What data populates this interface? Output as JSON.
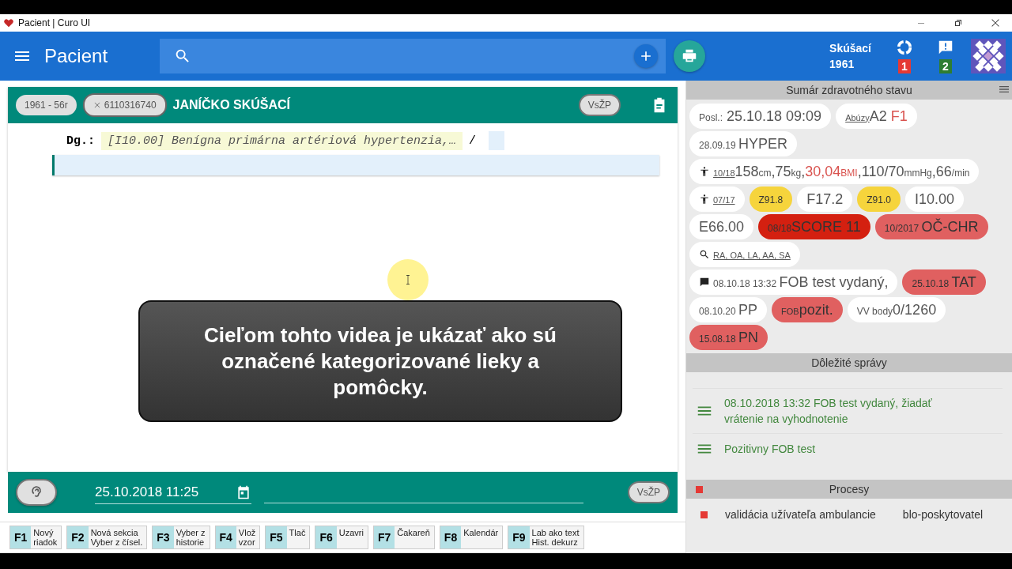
{
  "window": {
    "title": "Pacient | Curo UI"
  },
  "appbar": {
    "title": "Pacient",
    "user": {
      "name": "Skúšací",
      "year": "1961"
    },
    "sync_badge": "1",
    "messages_badge": "2"
  },
  "patient": {
    "age_chip": "1961 - 56r",
    "id_chip": "6110316740",
    "name": "JANÍČKO SKÚŠACÍ",
    "insurer": "VsŽP"
  },
  "editor": {
    "label": "Dg.:",
    "diagnosis": "[I10.00] Benígna primárna artériová hypertenzia,…",
    "separator": "/"
  },
  "caption": "Cieľom tohto videa je ukázať ako sú označené kategorizované lieky a pomôcky.",
  "footer": {
    "date": "25.10.2018 11:25",
    "insurer": "VsŽP"
  },
  "fkeys": [
    {
      "key": "F1",
      "label": "Nový\nriadok"
    },
    {
      "key": "F2",
      "label": "Nová sekcia\nVyber z čísel."
    },
    {
      "key": "F3",
      "label": "Vyber z\nhistorie"
    },
    {
      "key": "F4",
      "label": "Vlož\nvzor"
    },
    {
      "key": "F5",
      "label": "Tlač"
    },
    {
      "key": "F6",
      "label": "Uzavri"
    },
    {
      "key": "F7",
      "label": "Čakareň"
    },
    {
      "key": "F8",
      "label": "Kalendár"
    },
    {
      "key": "F9",
      "label": "Lab ako text\nHist. dekurz"
    }
  ],
  "summary": {
    "title": "Sumár zdravotného stavu",
    "chips": [
      {
        "color": "#ffffff",
        "kind": "plain",
        "parts": [
          {
            "text": "Posl.:",
            "kind": "small"
          },
          {
            "text": " 25.10.18 09:09",
            "kind": "value"
          }
        ]
      },
      {
        "color": "#ffffff",
        "kind": "plain",
        "parts": [
          {
            "text": "Abúzy",
            "kind": "link"
          },
          {
            "text": "A2 ",
            "kind": "value"
          },
          {
            "text": "F1",
            "kind": "alert"
          }
        ]
      },
      {
        "color": "#ffffff",
        "kind": "plain",
        "parts": [
          {
            "text": "28.09.19 ",
            "kind": "small"
          },
          {
            "text": "HYPER",
            "kind": "value"
          }
        ]
      },
      {
        "color": "#ffffff",
        "kind": "body",
        "parts": [
          {
            "text": "10/18",
            "kind": "link"
          },
          {
            "text": "158",
            "kind": "value"
          },
          {
            "text": "cm",
            "kind": "unit"
          },
          {
            "text": ",75",
            "kind": "value"
          },
          {
            "text": "kg",
            "kind": "unit"
          },
          {
            "text": ",",
            "kind": "value"
          },
          {
            "text": "30,04",
            "kind": "alert"
          },
          {
            "text": "BMI",
            "kind": "alertunit"
          },
          {
            "text": ",110/70",
            "kind": "value"
          },
          {
            "text": "mmHg",
            "kind": "unit"
          },
          {
            "text": ",66",
            "kind": "value"
          },
          {
            "text": "/min",
            "kind": "unit"
          }
        ]
      },
      {
        "color": "#ffffff",
        "kind": "body",
        "parts": [
          {
            "text": "07/17",
            "kind": "link"
          }
        ]
      },
      {
        "color": "#f6d43c",
        "kind": "plain",
        "parts": [
          {
            "text": "Z91.8",
            "kind": "small"
          }
        ]
      },
      {
        "color": "#ffffff",
        "kind": "plain",
        "parts": [
          {
            "text": "F17.2",
            "kind": "value"
          }
        ]
      },
      {
        "color": "#f6d43c",
        "kind": "plain",
        "parts": [
          {
            "text": "Z91.0",
            "kind": "small"
          }
        ]
      },
      {
        "color": "#ffffff",
        "kind": "plain",
        "parts": [
          {
            "text": "I10.00",
            "kind": "value"
          }
        ]
      },
      {
        "color": "#ffffff",
        "kind": "plain",
        "parts": [
          {
            "text": "E66.00",
            "kind": "value"
          }
        ]
      },
      {
        "color": "#d42010",
        "kind": "plain",
        "parts": [
          {
            "text": "08/18",
            "kind": "small"
          },
          {
            "text": "SCORE 11",
            "kind": "value"
          }
        ]
      },
      {
        "color": "#e06060",
        "kind": "plain",
        "parts": [
          {
            "text": "10/2017 ",
            "kind": "small"
          },
          {
            "text": "OČ-CHR",
            "kind": "value"
          }
        ]
      },
      {
        "color": "#ffffff",
        "kind": "lookup",
        "parts": [
          {
            "text": "RA, OA, LA, AA, SA",
            "kind": "link"
          }
        ]
      },
      {
        "color": "#ffffff",
        "kind": "note",
        "parts": [
          {
            "text": "08.10.18 13:32 ",
            "kind": "small"
          },
          {
            "text": "FOB test vydaný,",
            "kind": "value"
          }
        ]
      },
      {
        "color": "#e06060",
        "kind": "plain",
        "parts": [
          {
            "text": "25.10.18 ",
            "kind": "small"
          },
          {
            "text": "TAT",
            "kind": "value"
          }
        ]
      },
      {
        "color": "#ffffff",
        "kind": "plain",
        "parts": [
          {
            "text": "08.10.20 ",
            "kind": "small"
          },
          {
            "text": "PP",
            "kind": "value"
          }
        ]
      },
      {
        "color": "#e06060",
        "kind": "plain",
        "parts": [
          {
            "text": "FOB",
            "kind": "tiny"
          },
          {
            "text": "pozit.",
            "kind": "value"
          }
        ]
      },
      {
        "color": "#ffffff",
        "kind": "plain",
        "parts": [
          {
            "text": "VV body",
            "kind": "small"
          },
          {
            "text": "0/1260",
            "kind": "value"
          }
        ]
      },
      {
        "color": "#e06060",
        "kind": "plain",
        "parts": [
          {
            "text": "15.08.18 ",
            "kind": "small"
          },
          {
            "text": "PN",
            "kind": "value"
          }
        ]
      }
    ]
  },
  "messages": {
    "title": "Dôležité správy",
    "items": [
      "08.10.2018 13:32 FOB test vydaný, žiadať vrátenie na vyhodnotenie",
      "Pozitivny FOB test"
    ]
  },
  "processes": {
    "title": "Procesy",
    "items": [
      {
        "name": "validácia užívateľa ambulancie",
        "owner": "blo-poskytovatel"
      }
    ]
  }
}
